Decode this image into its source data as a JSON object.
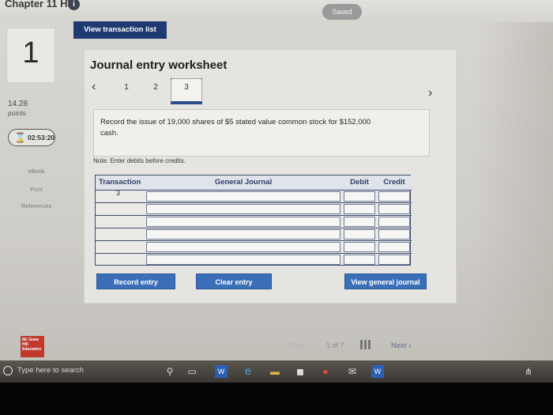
{
  "header": {
    "chapter_title": "Chapter 11 HW",
    "saved_label": "Saved",
    "view_transaction_list": "View transaction list"
  },
  "sidebar": {
    "question_number": "1",
    "points_value": "14.28",
    "points_label": "points",
    "timer": "02:53:20",
    "links": [
      "eBook",
      "Print",
      "References"
    ]
  },
  "worksheet": {
    "title": "Journal entry worksheet",
    "steps": [
      "1",
      "2",
      "3"
    ],
    "active_step": "3",
    "instruction": "Record the issue of 19,000 shares of $5 stated value common stock for $152,000 cash.",
    "note": "Note: Enter debits before credits.",
    "table": {
      "headers": {
        "transaction": "Transaction",
        "general_journal": "General Journal",
        "debit": "Debit",
        "credit": "Credit"
      },
      "transaction_number": "3",
      "row_count": 6
    },
    "buttons": {
      "record": "Record entry",
      "clear": "Clear entry",
      "view_journal": "View general journal"
    }
  },
  "pagination": {
    "prev": "Prev",
    "position": "1 of 7",
    "next": "Next"
  },
  "logo_text": "Mc Graw Hill Education",
  "taskbar": {
    "search_placeholder": "Type here to search"
  },
  "colors": {
    "primary_button": "#3a6fb8",
    "header_button": "#1e3a70",
    "table_border": "#3c4c6e",
    "logo_red": "#c0392b"
  }
}
